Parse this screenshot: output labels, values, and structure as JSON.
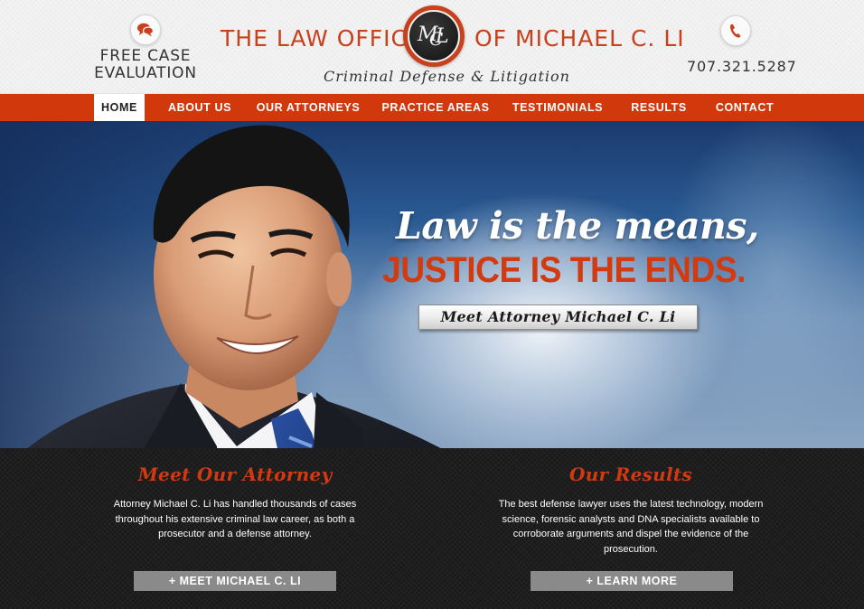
{
  "header": {
    "eval_icon": "chat-bubble-icon",
    "eval_line1": "FREE CASE",
    "eval_line2": "EVALUATION",
    "title_left": "THE LAW OFFICES",
    "title_right": "OF MICHAEL C. LI",
    "logo_text": "MCL",
    "tagline": "Criminal Defense & Litigation",
    "phone_icon": "phone-icon",
    "phone": "707.321.5287"
  },
  "nav": {
    "items": [
      {
        "label": "HOME",
        "active": true
      },
      {
        "label": "ABOUT US",
        "active": false
      },
      {
        "label": "OUR ATTORNEYS",
        "active": false
      },
      {
        "label": "PRACTICE AREAS",
        "active": false
      },
      {
        "label": "TESTIMONIALS",
        "active": false
      },
      {
        "label": "RESULTS",
        "active": false
      },
      {
        "label": "CONTACT",
        "active": false
      }
    ]
  },
  "hero": {
    "line1": "Law is the means,",
    "line2": "JUSTICE IS THE ENDS.",
    "button": "Meet Attorney Michael C. Li"
  },
  "panels": {
    "left": {
      "title": "Meet Our Attorney",
      "text": "Attorney Michael C. Li has handled thousands of cases throughout his extensive criminal law career, as both a prosecutor and a defense attorney.",
      "button": "+ MEET MICHAEL C. LI"
    },
    "right": {
      "title": "Our Results",
      "text": "The best defense lawyer uses the latest technology, modern science, forensic analysts and DNA specialists available to corroborate arguments and dispel the evidence of the prosecution.",
      "button": "+ LEARN MORE"
    }
  },
  "colors": {
    "brand_orange": "#d1390d",
    "title_orange": "#c8401c",
    "dark_panel": "#1a1a1a"
  }
}
